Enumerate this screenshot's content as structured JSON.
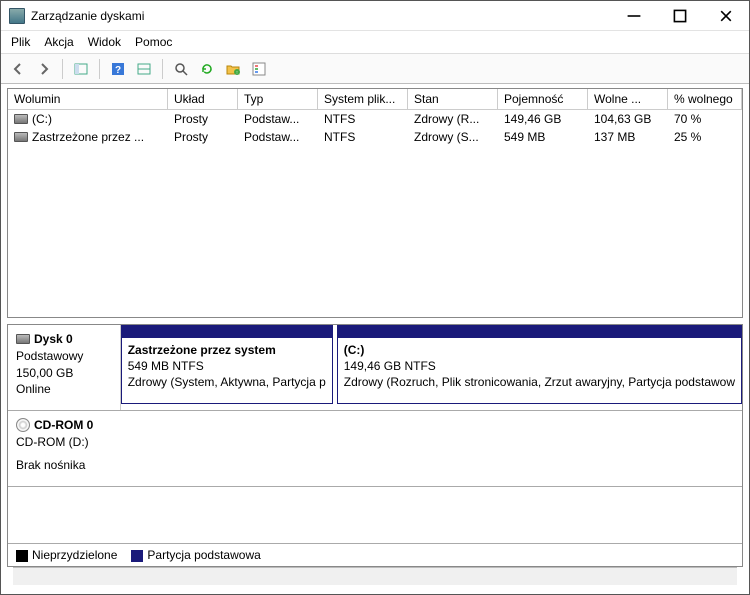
{
  "window": {
    "title": "Zarządzanie dyskami"
  },
  "menu": {
    "file": "Plik",
    "action": "Akcja",
    "view": "Widok",
    "help": "Pomoc"
  },
  "toolbar_icons": {
    "back": "back-icon",
    "forward": "forward-icon",
    "show_hide": "show-hide-icon",
    "help": "help-icon",
    "layout": "layout-icon",
    "find": "find-icon",
    "refresh": "refresh-icon",
    "folder": "folder-icon",
    "properties": "properties-icon"
  },
  "columns": {
    "volume": "Wolumin",
    "layout": "Układ",
    "type": "Typ",
    "fs": "System plik...",
    "status": "Stan",
    "capacity": "Pojemność",
    "free": "Wolne ...",
    "pct": "% wolnego"
  },
  "volumes": [
    {
      "name": "(C:)",
      "layout": "Prosty",
      "type": "Podstaw...",
      "fs": "NTFS",
      "status": "Zdrowy (R...",
      "capacity": "149,46 GB",
      "free": "104,63 GB",
      "pct": "70 %"
    },
    {
      "name": "Zastrzeżone przez ...",
      "layout": "Prosty",
      "type": "Podstaw...",
      "fs": "NTFS",
      "status": "Zdrowy (S...",
      "capacity": "549 MB",
      "free": "137 MB",
      "pct": "25 %"
    }
  ],
  "disk0": {
    "name": "Dysk 0",
    "type": "Podstawowy",
    "size": "150,00 GB",
    "state": "Online",
    "part1": {
      "name": "Zastrzeżone przez system",
      "info": "549 MB NTFS",
      "status": "Zdrowy (System, Aktywna, Partycja p"
    },
    "part2": {
      "name": "(C:)",
      "info": "149,46 GB NTFS",
      "status": "Zdrowy (Rozruch, Plik stronicowania, Zrzut awaryjny, Partycja podstawow"
    }
  },
  "cdrom": {
    "name": "CD-ROM 0",
    "drive": "CD-ROM (D:)",
    "state": "Brak nośnika"
  },
  "legend": {
    "unalloc": "Nieprzydzielone",
    "primary": "Partycja podstawowa"
  }
}
